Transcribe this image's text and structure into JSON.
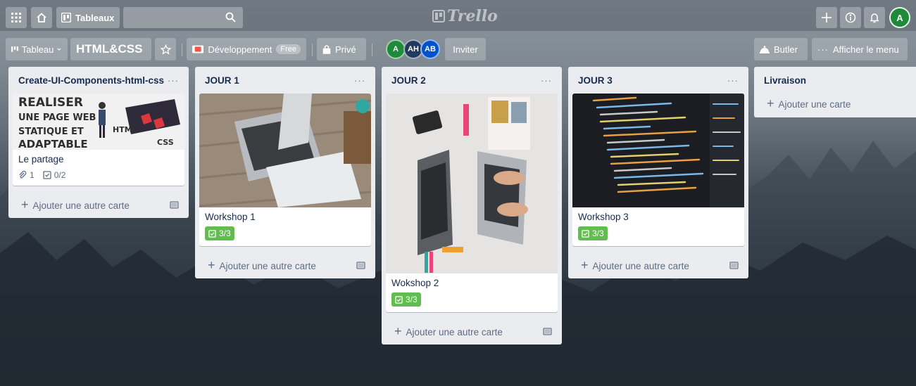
{
  "topbar": {
    "boards_label": "Tableaux",
    "search_value": "",
    "logo": "Trello",
    "avatar_initial": "A"
  },
  "boardbar": {
    "view_label": "Tableau",
    "board_title": "HTML&CSS",
    "workspace": "Développement",
    "workspace_badge": "Free",
    "visibility": "Privé",
    "members": [
      {
        "initials": "A",
        "color": "#1f8a3a"
      },
      {
        "initials": "AH",
        "color": "#223a5e"
      },
      {
        "initials": "AB",
        "color": "#0052cc"
      }
    ],
    "invite_label": "Inviter",
    "butler_label": "Butler",
    "menu_label": "Afficher le menu"
  },
  "lists": [
    {
      "title": "Create-UI-Components-html-css",
      "cards": [
        {
          "title": "Le partage",
          "cover_text": [
            "REALISER",
            "UNE PAGE WEB",
            "STATIQUE ET",
            "ADAPTABLE"
          ],
          "cover_tags": [
            "HTML",
            "CSS"
          ],
          "attachments": "1",
          "checklist": "0/2"
        }
      ],
      "add_label": "Ajouter une autre carte"
    },
    {
      "title": "JOUR 1",
      "cards": [
        {
          "title": "Workshop 1",
          "checklist": "3/3"
        }
      ],
      "add_label": "Ajouter une autre carte"
    },
    {
      "title": "JOUR 2",
      "cards": [
        {
          "title": "Wokshop 2",
          "checklist": "3/3"
        }
      ],
      "add_label": "Ajouter une autre carte"
    },
    {
      "title": "JOUR 3",
      "cards": [
        {
          "title": "Workshop 3",
          "checklist": "3/3"
        }
      ],
      "add_label": "Ajouter une autre carte"
    },
    {
      "title": "Livraison",
      "cards": [],
      "add_label": "Ajouter une carte"
    }
  ],
  "colors": {
    "label_green": "#61bd4f",
    "list_bg": "#ebecf0",
    "avatar_green": "#1f8a3a"
  }
}
